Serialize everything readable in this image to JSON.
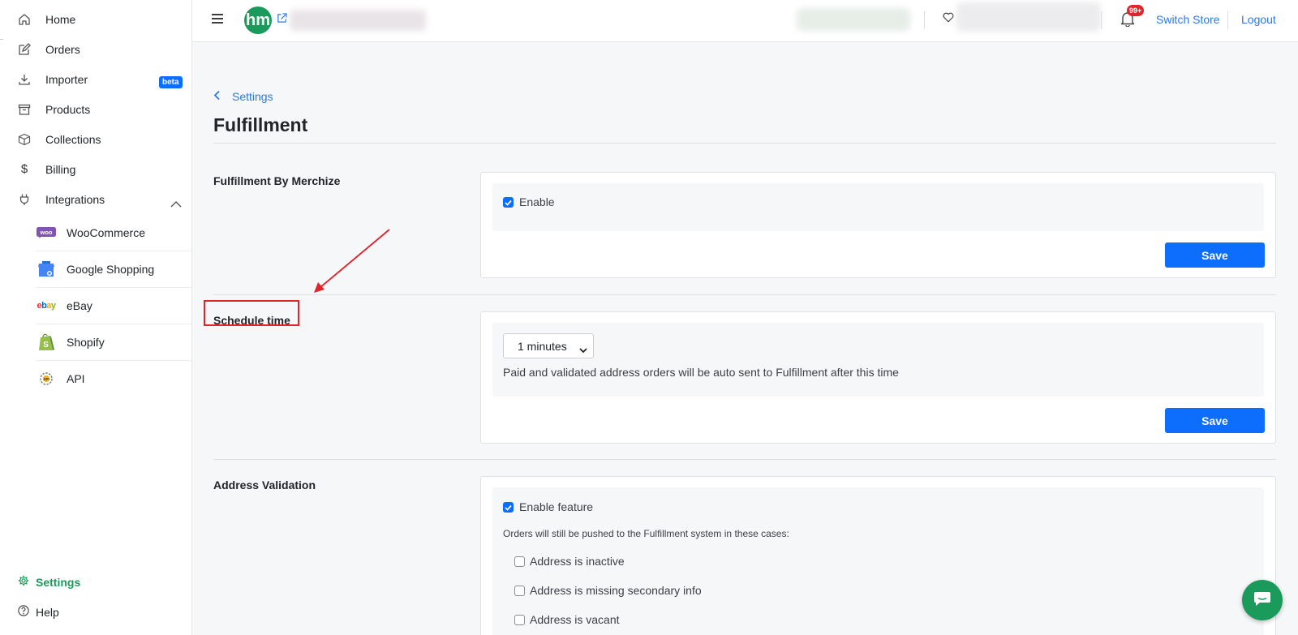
{
  "sidebar": {
    "items": [
      {
        "label": "Home",
        "icon": "home-icon"
      },
      {
        "label": "Orders",
        "icon": "edit-icon"
      },
      {
        "label": "Importer",
        "icon": "download-icon",
        "badge": "beta"
      },
      {
        "label": "Products",
        "icon": "archive-icon"
      },
      {
        "label": "Collections",
        "icon": "box-icon"
      },
      {
        "label": "Billing",
        "icon": "dollar-icon"
      },
      {
        "label": "Integrations",
        "icon": "plug-icon"
      }
    ],
    "integrations": [
      {
        "label": "WooCommerce",
        "icon": "woocommerce-icon"
      },
      {
        "label": "Google Shopping",
        "icon": "google-shopping-icon"
      },
      {
        "label": "eBay",
        "icon": "ebay-icon"
      },
      {
        "label": "Shopify",
        "icon": "shopify-icon"
      },
      {
        "label": "API",
        "icon": "api-icon"
      }
    ],
    "settings_label": "Settings",
    "help_label": "Help"
  },
  "topbar": {
    "logo_text": "hm",
    "notification_count": "99+",
    "switch_store": "Switch Store",
    "logout": "Logout"
  },
  "breadcrumb": {
    "back_label": "Settings"
  },
  "page": {
    "title": "Fulfillment"
  },
  "sections": {
    "fbm": {
      "label": "Fulfillment By Merchize",
      "enable_label": "Enable",
      "enabled": true,
      "save": "Save"
    },
    "schedule": {
      "label": "Schedule time",
      "select_value": "1 minutes",
      "help_text": "Paid and validated address orders will be auto sent to Fulfillment after this time",
      "save": "Save"
    },
    "address": {
      "label": "Address Validation",
      "enable_label": "Enable feature",
      "enabled": true,
      "note": "Orders will still be pushed to the Fulfillment system in these cases:",
      "options": [
        {
          "label": "Address is inactive",
          "checked": false
        },
        {
          "label": "Address is missing secondary info",
          "checked": false
        },
        {
          "label": "Address is vacant",
          "checked": false
        }
      ]
    }
  },
  "colors": {
    "brand_green": "#1a9b5b",
    "primary_blue": "#0d6efd",
    "link_blue": "#2b78e4",
    "badge_red": "#e0242c"
  }
}
